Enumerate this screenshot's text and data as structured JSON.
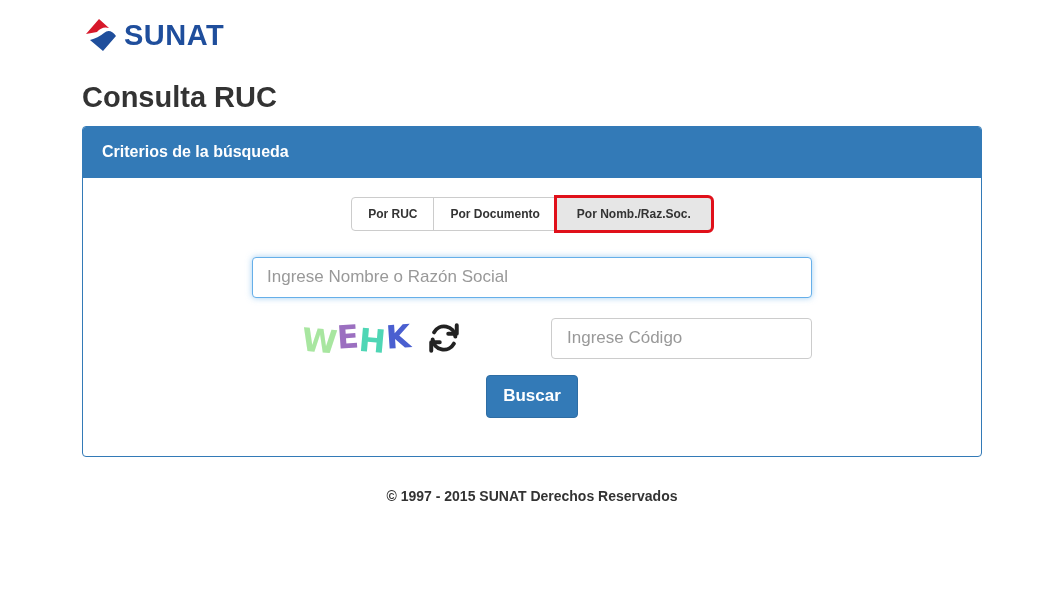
{
  "logo": {
    "text": "SUNAT"
  },
  "title": "Consulta RUC",
  "panel": {
    "heading": "Criterios de la búsqueda",
    "tabs": [
      {
        "label": "Por RUC",
        "selected": false
      },
      {
        "label": "Por Documento",
        "selected": false
      },
      {
        "label": "Por Nomb./Raz.Soc.",
        "selected": true
      }
    ],
    "name_field": {
      "placeholder": "Ingrese Nombre o Razón Social",
      "focused": true
    },
    "captcha": {
      "text": "WEHK"
    },
    "code_field": {
      "placeholder": "Ingrese Código"
    },
    "search_button": "Buscar"
  },
  "footer": "© 1997 - 2015 SUNAT Derechos Reservados"
}
